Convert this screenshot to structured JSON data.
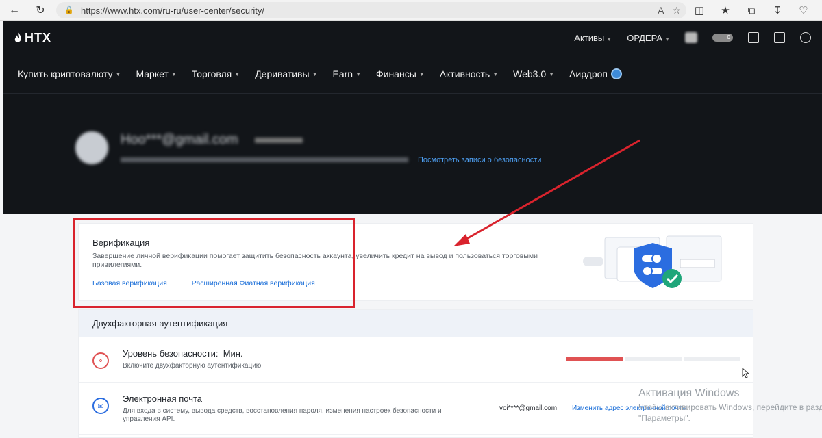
{
  "browser": {
    "url": "https://www.htx.com/ru-ru/user-center/security/"
  },
  "site": {
    "logo": "HTX",
    "top": {
      "assets": "Активы",
      "orders": "ОРДЕРА",
      "toggle_count": "0"
    },
    "nav": [
      {
        "label": "Купить криптовалюту"
      },
      {
        "label": "Маркет"
      },
      {
        "label": "Торговля"
      },
      {
        "label": "Деривативы"
      },
      {
        "label": "Earn"
      },
      {
        "label": "Финансы"
      },
      {
        "label": "Активность"
      },
      {
        "label": "Web3.0"
      },
      {
        "label": "Аирдроп"
      }
    ],
    "profile": {
      "email_masked": "Hoo***@gmail.com",
      "security_records_link": "Посмотреть записи о безопасности"
    }
  },
  "verification": {
    "title": "Верификация",
    "description": "Завершение личной верификации помогает защитить безопасность аккаунта, увеличить кредит на вывод и пользоваться торговыми привилегиями.",
    "basic_link": "Базовая верификация",
    "advanced_link": "Расширенная Фиатная верификация"
  },
  "two_factor": {
    "heading": "Двухфакторная аутентификация",
    "security_level": {
      "title": "Уровень безопасности:",
      "value": "Мин.",
      "desc": "Включите двухфакторную аутентификацию",
      "filled_segments": 1,
      "total_segments": 3
    },
    "email": {
      "title": "Электронная почта",
      "desc": "Для входа в систему, вывода средств, восстановления пароля, изменения настроек безопасности и управления API.",
      "value": "voi****@gmail.com",
      "change_link": "Изменить адрес электронной почты"
    }
  },
  "watermark": {
    "line1": "Активация Windows",
    "line2": "Чтобы активировать Windows, перейдите в раздел",
    "line3": "\"Параметры\"."
  },
  "colors": {
    "annotation_red": "#d9232d",
    "link_blue": "#1a6ed8",
    "security_bar": "#e05253"
  }
}
